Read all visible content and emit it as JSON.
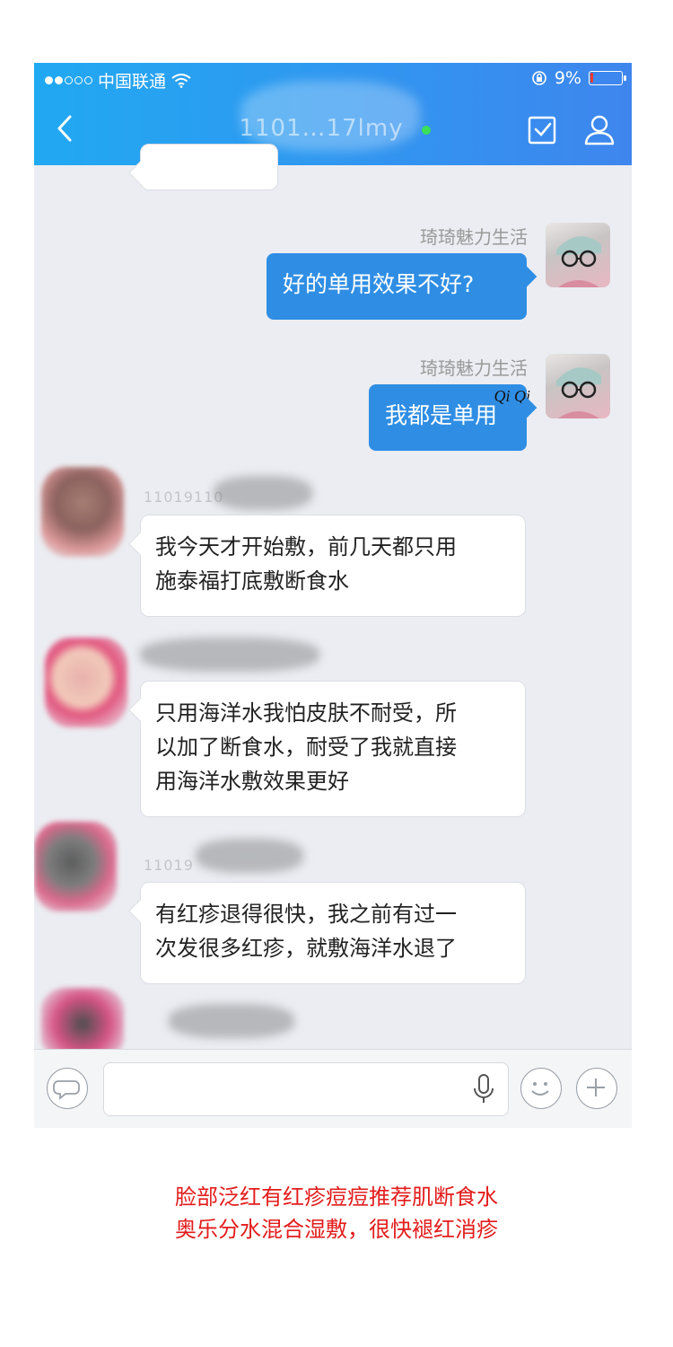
{
  "status": {
    "carrier": "中国联通",
    "battery": "9%",
    "battery_level": 0.09
  },
  "header": {
    "title": "1101…17lmy"
  },
  "messages": [
    {
      "type": "out",
      "sender": "琦琦魅力生活",
      "text": "好的单用效果不好?"
    },
    {
      "type": "out",
      "sender": "琦琦魅力生活",
      "text": "我都是单用",
      "stamp": "Qi Qi"
    },
    {
      "type": "in",
      "sender_id": "11019110",
      "lines": [
        "我今天才开始敷，前几天都只用",
        "施泰福打底敷断食水"
      ]
    },
    {
      "type": "in",
      "lines": [
        "只用海洋水我怕皮肤不耐受，所",
        "以加了断食水，耐受了我就直接",
        "用海洋水敷效果更好"
      ]
    },
    {
      "type": "in",
      "sender_id": "11019",
      "lines": [
        "有红疹退得很快，我之前有过一",
        "次发很多红疹，就敷海洋水退了"
      ]
    }
  ],
  "caption": {
    "line1": "脸部泛红有红疹痘痘推荐肌断食水",
    "line2": "奥乐分水混合湿敷，很快褪红消疹"
  },
  "icons": {
    "back": "chevron-left-icon",
    "task": "checkbox-icon",
    "profile": "person-icon",
    "voice": "microphone-icon",
    "emoji": "smile-icon",
    "add": "plus-icon",
    "speech": "speech-bubble-icon"
  },
  "colors": {
    "header_start": "#21a9f2",
    "header_end": "#3e86ee",
    "bubble_out": "#2f8ee4",
    "caption": "#e31c1c"
  }
}
